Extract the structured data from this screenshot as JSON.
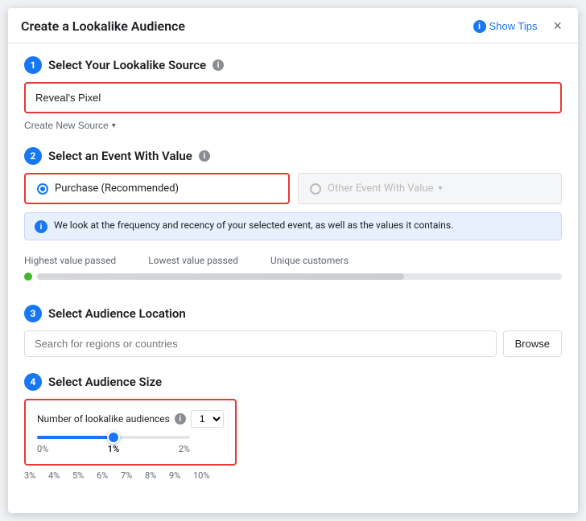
{
  "modal": {
    "title": "Create a Lookalike Audience",
    "close_label": "×"
  },
  "show_tips": {
    "label": "Show Tips",
    "icon_label": "i"
  },
  "sections": {
    "s1": {
      "step": "1",
      "title": "Select Your Lookalike Source",
      "source_value": "Reveal's Pixel",
      "create_new_label": "Create New Source"
    },
    "s2": {
      "step": "2",
      "title": "Select an Event With Value",
      "purchase_label": "Purchase (Recommended)",
      "other_event_label": "Other Event With Value",
      "info_text": "We look at the frequency and recency of your selected event, as well as the values it contains.",
      "metrics": {
        "label1": "Highest value passed",
        "label2": "Lowest value passed",
        "label3": "Unique customers"
      }
    },
    "s3": {
      "step": "3",
      "title": "Select Audience Location",
      "search_placeholder": "Search for regions or countries",
      "browse_label": "Browse"
    },
    "s4": {
      "step": "4",
      "title": "Select Audience Size",
      "lookalike_label": "Number of lookalike audiences",
      "dropdown_value": "1",
      "pct_labels": [
        "0%",
        "1%",
        "2%",
        "3%",
        "4%",
        "5%",
        "6%",
        "7%",
        "8%",
        "9%",
        "10%"
      ]
    }
  }
}
